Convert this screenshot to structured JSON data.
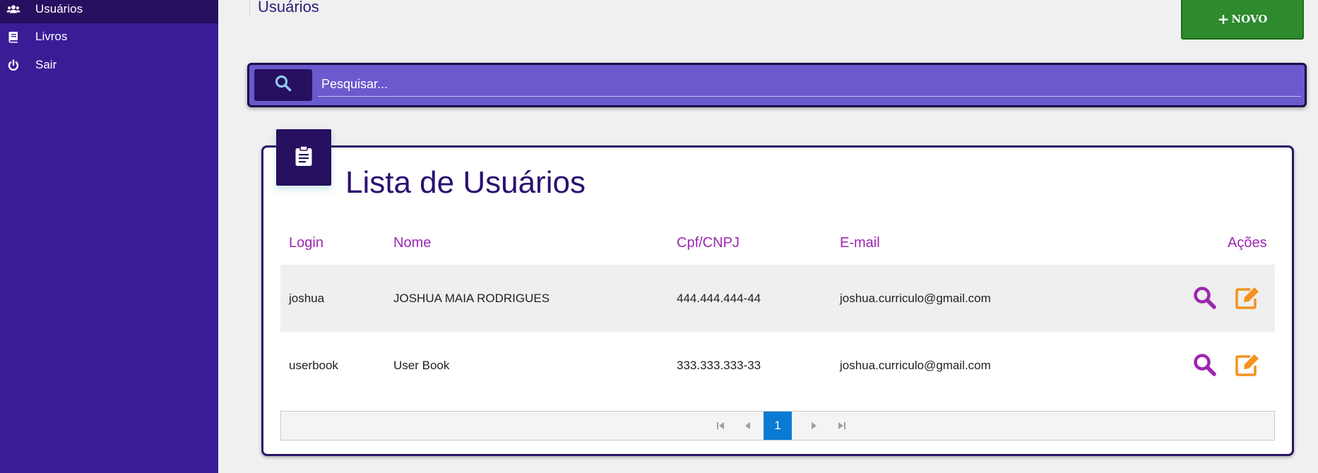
{
  "sidebar": {
    "items": [
      {
        "label": "Usuários",
        "icon": "users-icon",
        "active": true
      },
      {
        "label": "Livros",
        "icon": "book-icon",
        "active": false
      },
      {
        "label": "Sair",
        "icon": "power-icon",
        "active": false
      }
    ]
  },
  "header": {
    "title": "Usuários",
    "new_button": {
      "plus": "+",
      "label": "NOVO",
      "color": "#2d8a2d"
    }
  },
  "search": {
    "placeholder": "Pesquisar...",
    "value": "",
    "icon": "search-icon",
    "bar_color": "#6a5acd"
  },
  "card": {
    "icon": "clipboard-icon",
    "title": "Lista de Usuários"
  },
  "table": {
    "headers": {
      "login": "Login",
      "nome": "Nome",
      "cpf": "Cpf/CNPJ",
      "email": "E-mail",
      "acoes": "Ações"
    },
    "rows": [
      {
        "login": "joshua",
        "nome": "JOSHUA MAIA RODRIGUES",
        "cpf": "444.444.444-44",
        "email": "joshua.curriculo@gmail.com"
      },
      {
        "login": "userbook",
        "nome": "User Book",
        "cpf": "333.333.333-33",
        "email": "joshua.curriculo@gmail.com"
      }
    ],
    "actions": [
      {
        "name": "view",
        "icon": "search-icon",
        "color": "#9c27b0"
      },
      {
        "name": "edit",
        "icon": "edit-icon",
        "color": "#f5921e"
      }
    ]
  },
  "pagination": {
    "current_page": "1",
    "accent": "#0a7ad4"
  },
  "colors": {
    "sidebar": "#3a1d96",
    "sidebar_active": "#26105f",
    "header_accent": "#9c27b0"
  }
}
